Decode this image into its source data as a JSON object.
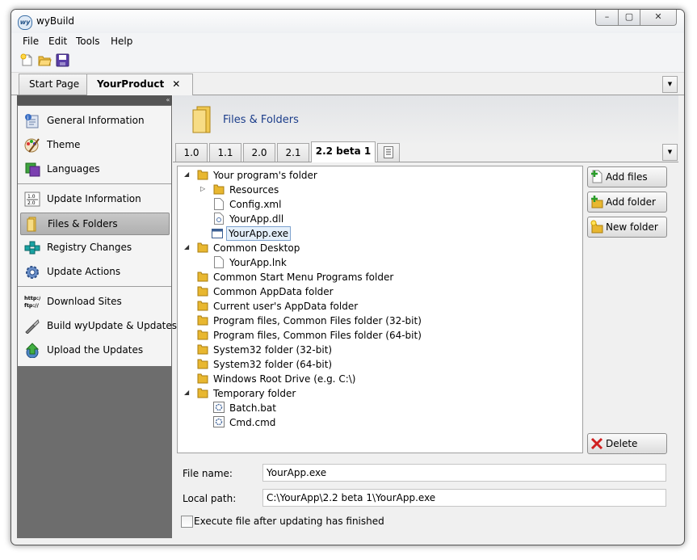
{
  "window": {
    "title": "wyBuild",
    "min_glyph": "–",
    "max_glyph": "▢",
    "close_glyph": "✕"
  },
  "menu": [
    "File",
    "Edit",
    "Tools",
    "Help"
  ],
  "toolbar": {
    "icons": [
      "new-icon",
      "open-icon",
      "save-icon"
    ]
  },
  "doc_tabs": [
    {
      "label": "Start Page",
      "active": false
    },
    {
      "label": "YourProduct",
      "active": true,
      "close_glyph": "✕"
    }
  ],
  "sidebar": {
    "collapse_glyph": "«",
    "items": [
      {
        "label": "General Information",
        "icon": "info-icon"
      },
      {
        "label": "Theme",
        "icon": "theme-icon"
      },
      {
        "label": "Languages",
        "icon": "languages-icon"
      },
      {
        "label": "Update Information",
        "icon": "version-icon",
        "icon_text": [
          "1.0",
          "2.0"
        ]
      },
      {
        "label": "Files & Folders",
        "icon": "folder-icon",
        "selected": true
      },
      {
        "label": "Registry Changes",
        "icon": "registry-icon"
      },
      {
        "label": "Update Actions",
        "icon": "gear-icon"
      },
      {
        "label": "Download Sites",
        "icon": "http-icon",
        "icon_text": [
          "http://",
          "ftp://"
        ]
      },
      {
        "label": "Build wyUpdate & Updates",
        "icon": "build-icon"
      },
      {
        "label": "Upload the Updates",
        "icon": "upload-icon"
      }
    ]
  },
  "header": {
    "title": "Files & Folders"
  },
  "version_tabs": [
    {
      "label": "1.0"
    },
    {
      "label": "1.1"
    },
    {
      "label": "2.0"
    },
    {
      "label": "2.1"
    },
    {
      "label": "2.2 beta 1",
      "active": true
    }
  ],
  "tree": [
    {
      "label": "Your program's folder",
      "type": "folder",
      "expanded": true,
      "expander": "◢"
    },
    {
      "label": "Resources",
      "type": "folder",
      "expander": "▷"
    },
    {
      "label": "Config.xml",
      "type": "file"
    },
    {
      "label": "YourApp.dll",
      "type": "file"
    },
    {
      "label": "YourApp.exe",
      "type": "exe",
      "selected": true
    },
    {
      "label": "Common Desktop",
      "type": "folder",
      "expanded": true,
      "expander": "◢"
    },
    {
      "label": "YourApp.lnk",
      "type": "file"
    },
    {
      "label": "Common Start Menu Programs folder",
      "type": "folder"
    },
    {
      "label": "Common AppData folder",
      "type": "folder"
    },
    {
      "label": "Current user's AppData folder",
      "type": "folder"
    },
    {
      "label": "Program files, Common Files folder (32-bit)",
      "type": "folder"
    },
    {
      "label": "Program files, Common Files folder (64-bit)",
      "type": "folder"
    },
    {
      "label": "System32 folder (32-bit)",
      "type": "folder"
    },
    {
      "label": "System32 folder (64-bit)",
      "type": "folder"
    },
    {
      "label": "Windows Root Drive (e.g. C:\\)",
      "type": "folder"
    },
    {
      "label": "Temporary folder",
      "type": "folder",
      "expanded": true,
      "expander": "◢"
    },
    {
      "label": "Batch.bat",
      "type": "script"
    },
    {
      "label": "Cmd.cmd",
      "type": "script"
    }
  ],
  "buttons": {
    "add_files": "Add files",
    "add_folder": "Add folder",
    "new_folder": "New folder",
    "delete": "Delete"
  },
  "fields": {
    "file_name_label": "File name:",
    "file_name": "YourApp.exe",
    "local_path_label": "Local path:",
    "local_path": "C:\\YourApp\\2.2 beta 1\\YourApp.exe"
  },
  "execute_checkbox": {
    "label": "Execute file after updating has finished",
    "checked": false
  },
  "colors": {
    "accent_title": "#1b3d8a",
    "sidebar_bg": "#6d6d6d",
    "folder": "#e8b730"
  }
}
